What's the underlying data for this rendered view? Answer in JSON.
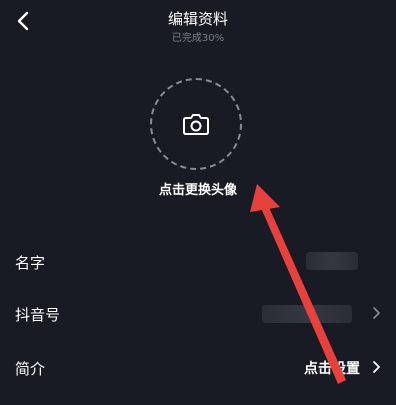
{
  "header": {
    "title": "编辑资料",
    "subtitle": "已完成30%",
    "back_icon": "chevron-left-icon"
  },
  "avatar": {
    "icon": "camera-icon",
    "label": "点击更换头像"
  },
  "rows": {
    "name": {
      "label": "名字"
    },
    "douyin_id": {
      "label": "抖音号",
      "chevron_icon": "chevron-right-icon"
    },
    "bio": {
      "label": "简介",
      "value": "点击设置",
      "chevron_icon": "chevron-right-icon"
    }
  },
  "colors": {
    "background": "#181a24",
    "text": "#ffffff",
    "muted": "#7d7f88",
    "annotation_arrow": "#e8413c"
  }
}
